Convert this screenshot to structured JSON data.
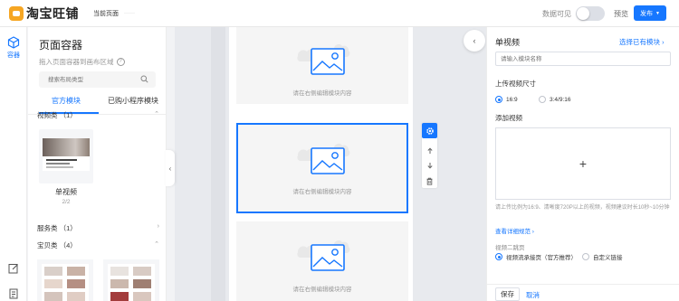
{
  "header": {
    "logo_text": "淘宝旺铺",
    "breadcrumb": "当前页面",
    "breadcrumb_extra": "······",
    "data_visible_label": "数据可见",
    "data_visible_on": false,
    "preview_label": "预览",
    "publish_label": "发布"
  },
  "rail": {
    "container_label": "容器"
  },
  "panel": {
    "title": "页面容器",
    "subtitle": "拖入页面容器到画布区域",
    "search_placeholder": "搜索布局类型",
    "tabs": [
      "官方模块",
      "已购小程序模块"
    ],
    "active_tab": 0,
    "categories": [
      {
        "label": "视频类 （1）",
        "expanded": true
      },
      {
        "label": "服务类 （1）",
        "expanded": false
      },
      {
        "label": "宝贝类 （4）",
        "expanded": true
      }
    ],
    "video_item": {
      "name": "单视频",
      "count": "2/2"
    }
  },
  "canvas": {
    "placeholder_text": "请在右侧编辑模块内容"
  },
  "props": {
    "title": "单视频",
    "select_module_link": "选择已有模块 ›",
    "name_placeholder": "请输入模块名称",
    "size_label": "上传视频尺寸",
    "size_options": [
      "16:9",
      "3:4/9:16"
    ],
    "size_selected": 0,
    "add_video_label": "添加视频",
    "add_symbol": "+",
    "upload_tip": "请上传比例为16:9、清晰度720P以上的视频，视频建议时长10秒~10分钟",
    "spec_link": "查看详细规范 ›",
    "second_jump_label": "视频二跳页",
    "second_jump_options": [
      "视频流承接页（官方推荐）",
      "自定义链接"
    ],
    "second_jump_selected": 0,
    "save_label": "保存",
    "cancel_label": "取消"
  },
  "colors": {
    "accent": "#1677ff",
    "logo": "#f6a623"
  }
}
